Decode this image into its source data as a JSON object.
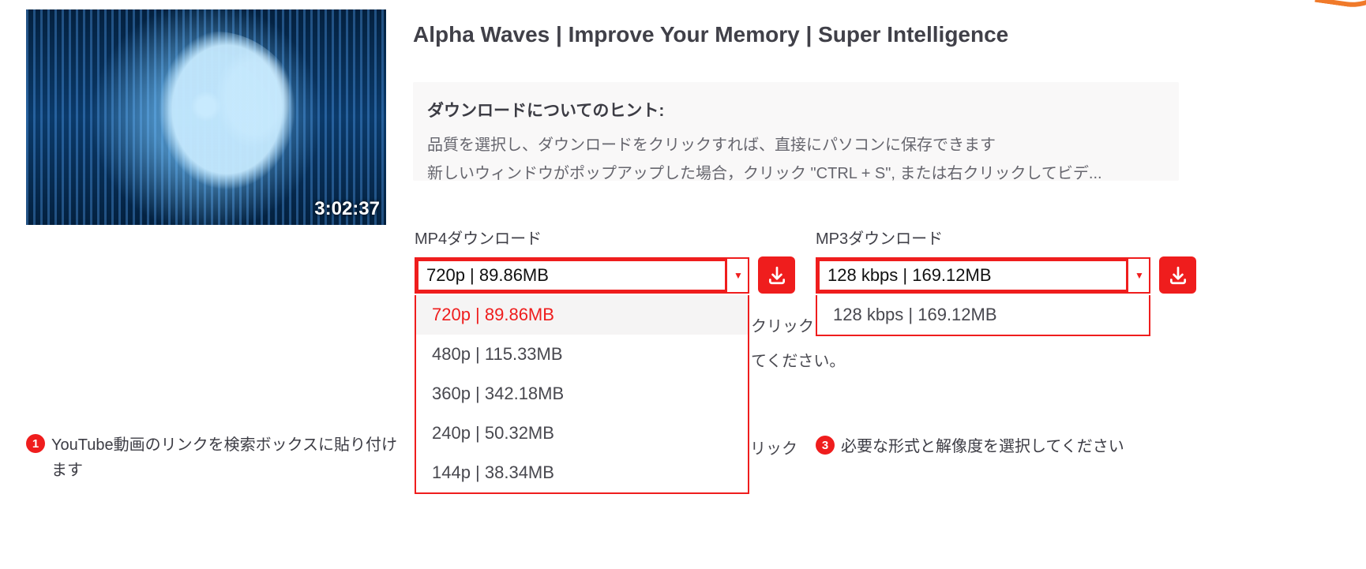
{
  "video": {
    "title": "Alpha Waves | Improve Your Memory | Super Intelligence",
    "duration": "3:02:37"
  },
  "hint": {
    "title": "ダウンロードについてのヒント:",
    "line1": "品質を選択し、ダウンロードをクリックすれば、直接にパソコンに保存できます",
    "line2": "新しいウィンドウがポップアップした場合，クリック \"CTRL + S\", または右クリックしてビデ..."
  },
  "mp4": {
    "label": "MP4ダウンロード",
    "selected": "720p | 89.86MB",
    "options": [
      "720p | 89.86MB",
      "480p | 115.33MB",
      "360p | 342.18MB",
      "240p | 50.32MB",
      "144p | 38.34MB"
    ]
  },
  "mp3": {
    "label": "MP3ダウンロード",
    "selected": "128 kbps | 169.12MB",
    "options": [
      "128 kbps | 169.12MB"
    ]
  },
  "peek": {
    "a": "クリック",
    "b": "てください。",
    "c": "リック"
  },
  "steps": {
    "s1": {
      "num": "1",
      "text": "YouTube動画のリンクを検索ボックスに貼り付けます"
    },
    "s3": {
      "num": "3",
      "text": "必要な形式と解像度を選択してください"
    }
  }
}
